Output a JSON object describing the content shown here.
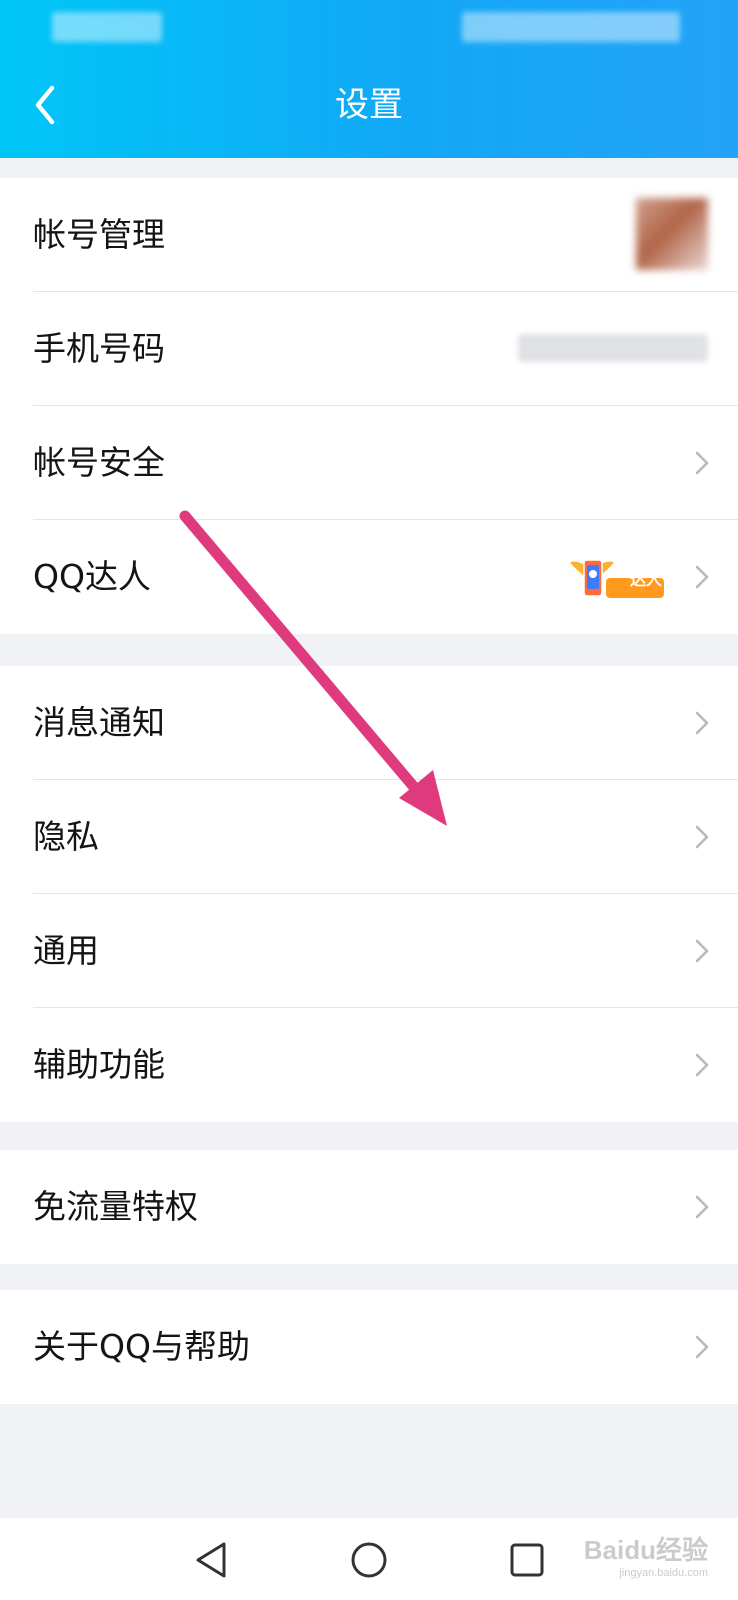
{
  "header": {
    "title": "设置",
    "back_icon": "chevron-left-icon"
  },
  "groups": [
    {
      "items": [
        {
          "label": "帐号管理",
          "trailing": "blurred-avatar"
        },
        {
          "label": "手机号码",
          "trailing": "blurred-phone-number"
        },
        {
          "label": "帐号安全",
          "trailing": "chevron-right-icon"
        },
        {
          "label": "QQ达人",
          "trailing": "qq-daren-badge",
          "badge_text": "达人"
        }
      ]
    },
    {
      "items": [
        {
          "label": "消息通知",
          "trailing": "chevron-right-icon"
        },
        {
          "label": "隐私",
          "trailing": "chevron-right-icon"
        },
        {
          "label": "通用",
          "trailing": "chevron-right-icon"
        },
        {
          "label": "辅助功能",
          "trailing": "chevron-right-icon"
        }
      ]
    },
    {
      "items": [
        {
          "label": "免流量特权",
          "trailing": "chevron-right-icon"
        }
      ]
    },
    {
      "items": [
        {
          "label": "关于QQ与帮助",
          "trailing": "chevron-right-icon"
        }
      ]
    }
  ],
  "annotation": {
    "type": "arrow",
    "color": "#e03a7e"
  },
  "system_nav": {
    "icons": [
      "back-triangle-icon",
      "home-circle-icon",
      "recents-square-icon"
    ]
  },
  "watermark": {
    "text": "Baidu经验",
    "subtext": "jingyan.baidu.com"
  },
  "colors": {
    "header_start": "#00c6f7",
    "header_end": "#23a3f7",
    "background": "#f1f2f6"
  }
}
